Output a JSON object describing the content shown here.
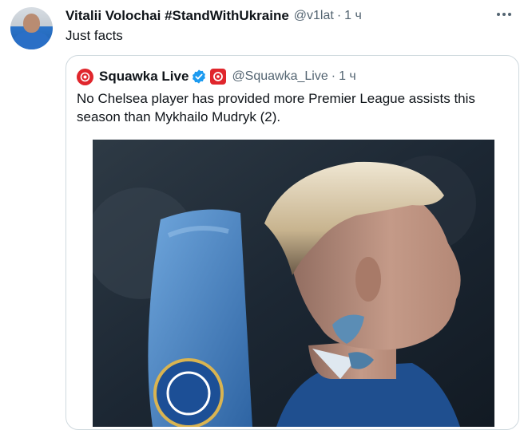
{
  "tweet": {
    "author_name": "Vitalii Volochai #StandWithUkraine",
    "author_handle": "@v1lat",
    "separator": "·",
    "time": "1 ч",
    "text": "Just facts",
    "more_icon": "more-horizontal-icon"
  },
  "quoted_tweet": {
    "author_name": "Squawka Live",
    "verified": true,
    "verified_icon": "verified-badge-icon",
    "affiliate_icon": "squawka-logo-icon",
    "author_handle": "@Squawka_Live",
    "separator": "·",
    "time": "1 ч",
    "text": "No Chelsea player has provided more Premier League assists this season than Mykhailo Mudryk (2).",
    "media": "photo",
    "colors": {
      "brand": "#e0262c",
      "verified": "#1d9bf0"
    }
  }
}
